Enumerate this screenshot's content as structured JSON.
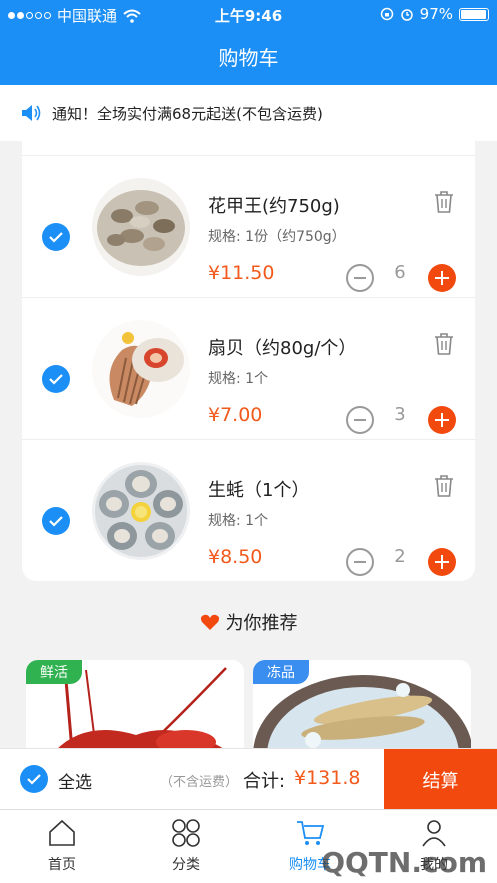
{
  "status_bar": {
    "carrier": "中国联通",
    "time": "上午9:46",
    "battery": "97%",
    "battery_level": 0.97
  },
  "header": {
    "title": "购物车"
  },
  "notice": {
    "text": "通知！全场实付满68元起送(不包含运费)"
  },
  "cart": {
    "items": [
      {
        "name": "花甲王(约750g)",
        "spec": "规格:  1份（约750g）",
        "price": "¥11.50",
        "qty": "6"
      },
      {
        "name": "扇贝（约80g/个）",
        "spec": "规格:  1个",
        "price": "¥7.00",
        "qty": "3"
      },
      {
        "name": "生蚝（1个）",
        "spec": "规格:  1个",
        "price": "¥8.50",
        "qty": "2"
      }
    ]
  },
  "recommend": {
    "title": "为你推荐",
    "cards": [
      {
        "tag": "鲜活"
      },
      {
        "tag": "冻品"
      }
    ]
  },
  "checkout": {
    "select_all": "全选",
    "shipping_note": "（不含运费）",
    "total_label": "合计:",
    "total": "¥131.8",
    "pay_label": "结算"
  },
  "tabbar": {
    "tabs": [
      {
        "label": "首页",
        "icon": "home-icon"
      },
      {
        "label": "分类",
        "icon": "category-icon"
      },
      {
        "label": "购物车",
        "icon": "cart-icon"
      },
      {
        "label": "我的",
        "icon": "user-icon"
      }
    ]
  },
  "watermark": "QQTN.com",
  "colors": {
    "primary": "#1b8ff5",
    "accent": "#f25a1c",
    "fresh_tag": "#2fb24f",
    "frozen_tag": "#3a8ef0"
  }
}
